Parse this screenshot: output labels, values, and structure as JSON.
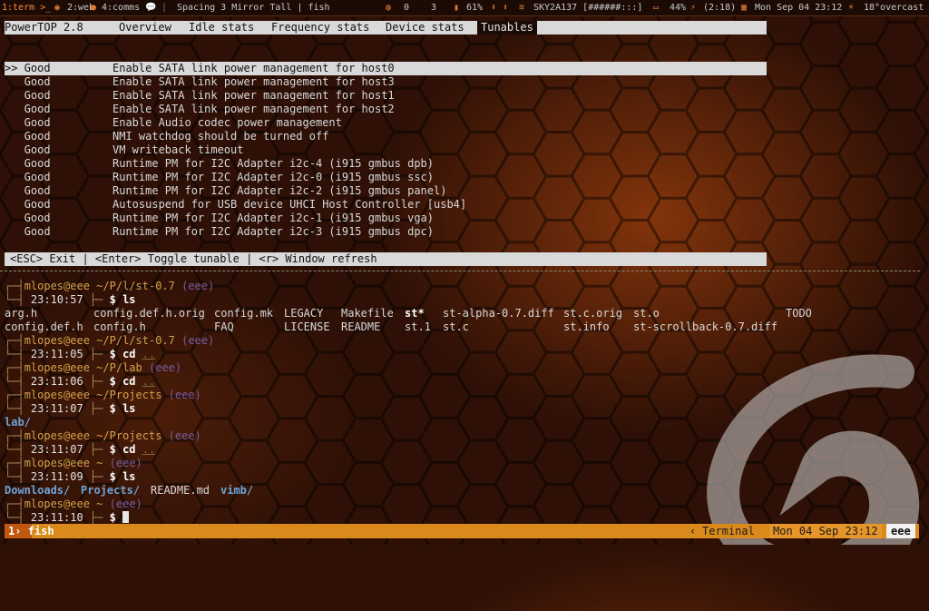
{
  "topbar": {
    "workspaces": [
      "1:term >_",
      "2:web",
      "4:comms",
      "💬"
    ],
    "window_title": "Spacing 3 Mirror Tall | fish",
    "stats": {
      "steam": "0",
      "count": "3",
      "disk": "61%",
      "wifi": "SKY2A137 [######:::]",
      "battery": "44%",
      "battery_time": "(2:18)",
      "clock": "Mon Sep 04 23:12",
      "weather": "18°overcast"
    }
  },
  "powertop": {
    "app": "PowerTOP 2.8",
    "tabs": [
      "Overview",
      "Idle stats",
      "Frequency stats",
      "Device stats",
      "Tunables"
    ],
    "active_tab": "Tunables",
    "tunables": [
      {
        "status": ">> Good",
        "desc": "Enable SATA link power management for host0"
      },
      {
        "status": "   Good",
        "desc": "Enable SATA link power management for host3"
      },
      {
        "status": "   Good",
        "desc": "Enable SATA link power management for host1"
      },
      {
        "status": "   Good",
        "desc": "Enable SATA link power management for host2"
      },
      {
        "status": "   Good",
        "desc": "Enable Audio codec power management"
      },
      {
        "status": "   Good",
        "desc": "NMI watchdog should be turned off"
      },
      {
        "status": "   Good",
        "desc": "VM writeback timeout"
      },
      {
        "status": "   Good",
        "desc": "Runtime PM for I2C Adapter i2c-4 (i915 gmbus dpb)"
      },
      {
        "status": "   Good",
        "desc": "Runtime PM for I2C Adapter i2c-0 (i915 gmbus ssc)"
      },
      {
        "status": "   Good",
        "desc": "Runtime PM for I2C Adapter i2c-2 (i915 gmbus panel)"
      },
      {
        "status": "   Good",
        "desc": "Autosuspend for USB device UHCI Host Controller [usb4]"
      },
      {
        "status": "   Good",
        "desc": "Runtime PM for I2C Adapter i2c-1 (i915 gmbus vga)"
      },
      {
        "status": "   Good",
        "desc": "Runtime PM for I2C Adapter i2c-3 (i915 gmbus dpc)"
      }
    ],
    "footer": "<ESC> Exit | <Enter> Toggle tunable | <r> Window refresh"
  },
  "shell": {
    "user_host": "mlopes@eee",
    "host_tag": "(eee)",
    "prompt_char": "$",
    "p1": {
      "path": "~/P/l/st-0.7",
      "time": "23:10:57",
      "cmd": "ls"
    },
    "ls1": {
      "row1": [
        "arg.h",
        "config.def.h.orig",
        "config.mk",
        "LEGACY",
        "Makefile",
        "st*",
        "st-alpha-0.7.diff",
        "st.c.orig",
        "st.o",
        "TODO"
      ],
      "row2": [
        "config.def.h",
        "config.h",
        "FAQ",
        "LICENSE",
        "README",
        "st.1",
        "st.c",
        "st.info",
        "st-scrollback-0.7.diff"
      ]
    },
    "p2": {
      "path": "~/P/l/st-0.7",
      "time": "23:11:05",
      "cmd": "cd",
      "arg": ".."
    },
    "p3": {
      "path": "~/P/lab",
      "time": "23:11:06",
      "cmd": "cd",
      "arg": ".."
    },
    "p4": {
      "path": "~/Projects",
      "time": "23:11:07",
      "cmd": "ls"
    },
    "ls2": [
      "lab/"
    ],
    "p5": {
      "path": "~/Projects",
      "time": "23:11:07",
      "cmd": "cd",
      "arg": ".."
    },
    "p6": {
      "path": "~",
      "time": "23:11:09",
      "cmd": "ls"
    },
    "ls3": [
      "Downloads/",
      "Projects/",
      "README.md",
      "vimb/"
    ],
    "p7": {
      "path": "~",
      "time": "23:11:10"
    }
  },
  "tmux": {
    "window_index": "1",
    "window_name": "fish",
    "right_title": "Terminal",
    "right_clock": "Mon 04 Sep 23:12",
    "right_host": "eee"
  },
  "colors": {
    "accent": "#d98a1a",
    "bg": "#2e1006"
  }
}
